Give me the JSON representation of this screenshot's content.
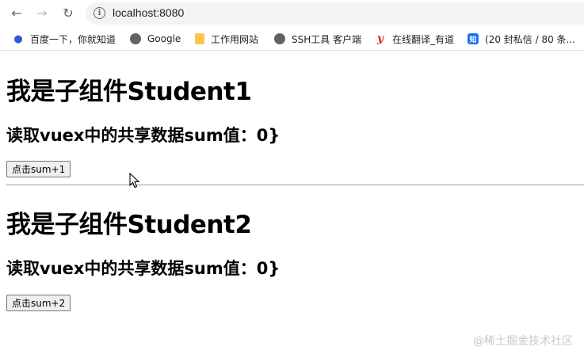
{
  "browser": {
    "url": "localhost:8080",
    "back_icon": "←",
    "forward_icon": "→",
    "reload_icon": "↻",
    "info_icon": "i"
  },
  "bookmarks": [
    {
      "icon": "paw-icon",
      "glyph": "🐾",
      "label": "百度一下，你就知道"
    },
    {
      "icon": "globe-icon",
      "glyph": "●",
      "label": "Google"
    },
    {
      "icon": "folder-icon",
      "glyph": "",
      "label": "工作用网站"
    },
    {
      "icon": "globe-icon",
      "glyph": "●",
      "label": "SSH工具 客户端"
    },
    {
      "icon": "youdao-icon",
      "glyph": "y",
      "label": "在线翻译_有道"
    },
    {
      "icon": "zhihu-icon",
      "glyph": "知",
      "label": "(20 封私信 / 80 条..."
    }
  ],
  "student1": {
    "title": "我是子组件Student1",
    "subtitle": "读取vuex中的共享数据sum值：0}",
    "button": "点击sum+1"
  },
  "student2": {
    "title": "我是子组件Student2",
    "subtitle": "读取vuex中的共享数据sum值：0}",
    "button": "点击sum+2"
  },
  "watermark": "@稀土掘金技术社区"
}
